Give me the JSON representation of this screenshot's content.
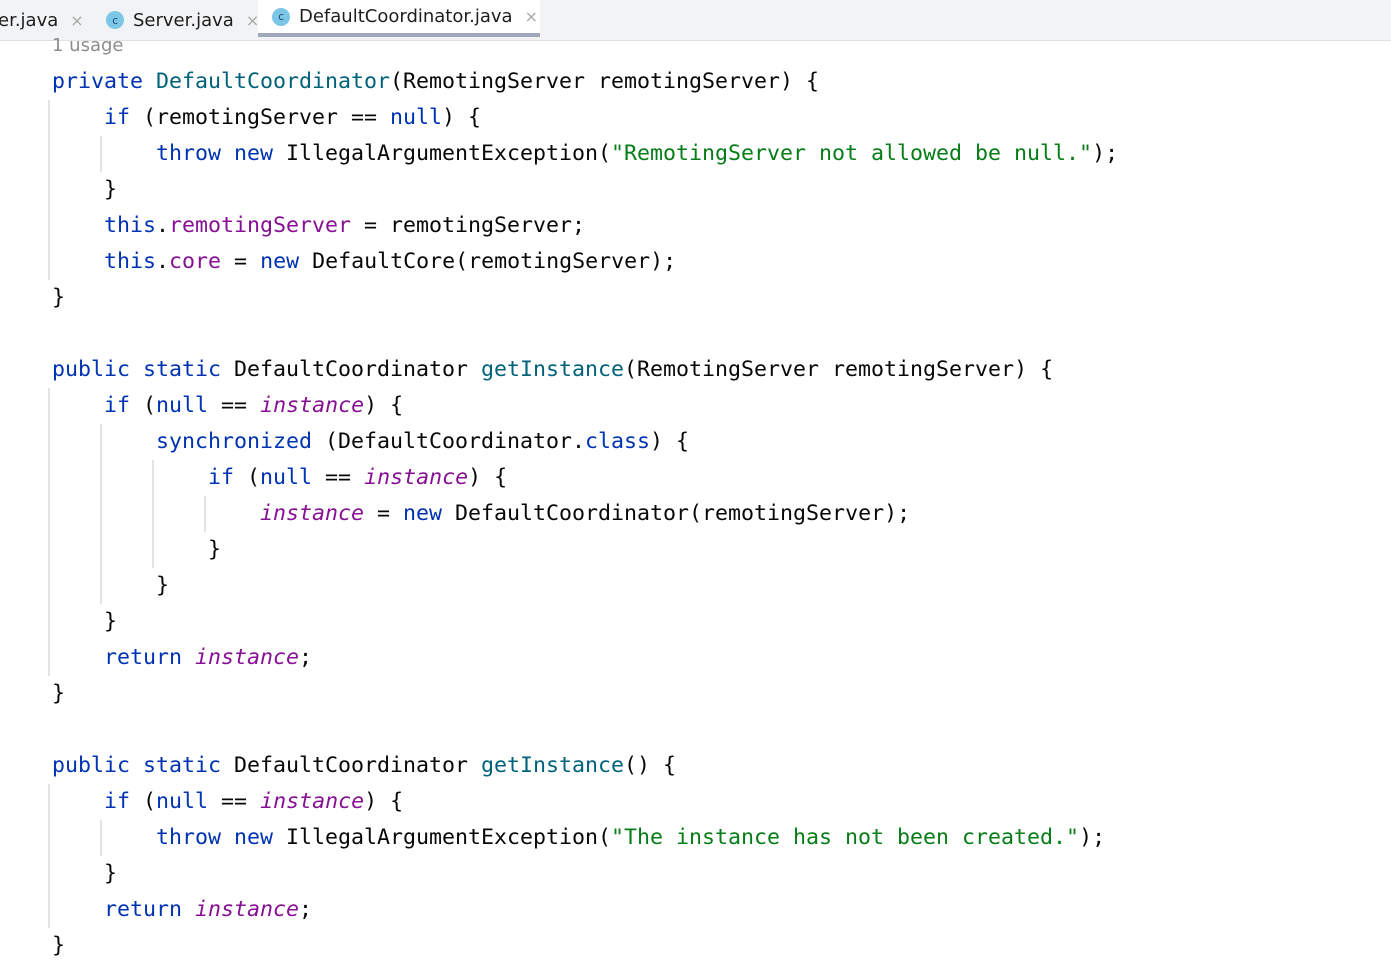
{
  "tabs": [
    {
      "label": "er.java",
      "icon": "class-icon",
      "active": false
    },
    {
      "label": "Server.java",
      "icon": "class-icon",
      "active": false
    },
    {
      "label": "DefaultCoordinator.java",
      "icon": "class-icon",
      "active": true
    }
  ],
  "class_icon_letter": "c",
  "close_glyph": "×",
  "usage_hint": "1 usage",
  "colors": {
    "keyword": "#0033b3",
    "method": "#00627a",
    "field": "#871094",
    "string": "#067d17",
    "text": "#080808"
  },
  "code_lines": [
    {
      "indent": 0,
      "tokens": [
        [
          "private ",
          "kw"
        ],
        [
          "DefaultCoordinator",
          "md"
        ],
        [
          "(RemotingServer remotingServer) {",
          "tx"
        ]
      ]
    },
    {
      "indent": 1,
      "tokens": [
        [
          "if ",
          "kw"
        ],
        [
          "(remotingServer == ",
          "tx"
        ],
        [
          "null",
          "kw"
        ],
        [
          ") {",
          "tx"
        ]
      ]
    },
    {
      "indent": 2,
      "tokens": [
        [
          "throw new ",
          "kw"
        ],
        [
          "IllegalArgumentException(",
          "tx"
        ],
        [
          "\"RemotingServer not allowed be null.\"",
          "st"
        ],
        [
          ");",
          "tx"
        ]
      ]
    },
    {
      "indent": 1,
      "tokens": [
        [
          "}",
          "tx"
        ]
      ]
    },
    {
      "indent": 1,
      "tokens": [
        [
          "this",
          "kw"
        ],
        [
          ".",
          "tx"
        ],
        [
          "remotingServer",
          "fd"
        ],
        [
          " = remotingServer;",
          "tx"
        ]
      ]
    },
    {
      "indent": 1,
      "tokens": [
        [
          "this",
          "kw"
        ],
        [
          ".",
          "tx"
        ],
        [
          "core",
          "fd"
        ],
        [
          " = ",
          "tx"
        ],
        [
          "new ",
          "kw"
        ],
        [
          "DefaultCore(remotingServer);",
          "tx"
        ]
      ]
    },
    {
      "indent": 0,
      "tokens": [
        [
          "}",
          "tx"
        ]
      ]
    },
    {
      "indent": 0,
      "tokens": []
    },
    {
      "indent": 0,
      "tokens": [
        [
          "public static ",
          "kw"
        ],
        [
          "DefaultCoordinator ",
          "tx"
        ],
        [
          "getInstance",
          "md"
        ],
        [
          "(RemotingServer remotingServer) {",
          "tx"
        ]
      ]
    },
    {
      "indent": 1,
      "tokens": [
        [
          "if ",
          "kw"
        ],
        [
          "(",
          "tx"
        ],
        [
          "null",
          "kw"
        ],
        [
          " == ",
          "tx"
        ],
        [
          "instance",
          "fd it"
        ],
        [
          ") {",
          "tx"
        ]
      ]
    },
    {
      "indent": 2,
      "tokens": [
        [
          "synchronized ",
          "kw"
        ],
        [
          "(DefaultCoordinator.",
          "tx"
        ],
        [
          "class",
          "kw"
        ],
        [
          ") {",
          "tx"
        ]
      ]
    },
    {
      "indent": 3,
      "tokens": [
        [
          "if ",
          "kw"
        ],
        [
          "(",
          "tx"
        ],
        [
          "null",
          "kw"
        ],
        [
          " == ",
          "tx"
        ],
        [
          "instance",
          "fd it"
        ],
        [
          ") {",
          "tx"
        ]
      ]
    },
    {
      "indent": 4,
      "tokens": [
        [
          "instance",
          "fd it"
        ],
        [
          " = ",
          "tx"
        ],
        [
          "new ",
          "kw"
        ],
        [
          "DefaultCoordinator(remotingServer);",
          "tx"
        ]
      ]
    },
    {
      "indent": 3,
      "tokens": [
        [
          "}",
          "tx"
        ]
      ]
    },
    {
      "indent": 2,
      "tokens": [
        [
          "}",
          "tx"
        ]
      ]
    },
    {
      "indent": 1,
      "tokens": [
        [
          "}",
          "tx"
        ]
      ]
    },
    {
      "indent": 1,
      "tokens": [
        [
          "return ",
          "kw"
        ],
        [
          "instance",
          "fd it"
        ],
        [
          ";",
          "tx"
        ]
      ]
    },
    {
      "indent": 0,
      "tokens": [
        [
          "}",
          "tx"
        ]
      ]
    },
    {
      "indent": 0,
      "tokens": []
    },
    {
      "indent": 0,
      "tokens": [
        [
          "public static ",
          "kw"
        ],
        [
          "DefaultCoordinator ",
          "tx"
        ],
        [
          "getInstance",
          "md"
        ],
        [
          "() {",
          "tx"
        ]
      ]
    },
    {
      "indent": 1,
      "tokens": [
        [
          "if ",
          "kw"
        ],
        [
          "(",
          "tx"
        ],
        [
          "null",
          "kw"
        ],
        [
          " == ",
          "tx"
        ],
        [
          "instance",
          "fd it"
        ],
        [
          ") {",
          "tx"
        ]
      ]
    },
    {
      "indent": 2,
      "tokens": [
        [
          "throw new ",
          "kw"
        ],
        [
          "IllegalArgumentException(",
          "tx"
        ],
        [
          "\"The instance has not been created.\"",
          "st"
        ],
        [
          ");",
          "tx"
        ]
      ]
    },
    {
      "indent": 1,
      "tokens": [
        [
          "}",
          "tx"
        ]
      ]
    },
    {
      "indent": 1,
      "tokens": [
        [
          "return ",
          "kw"
        ],
        [
          "instance",
          "fd it"
        ],
        [
          ";",
          "tx"
        ]
      ]
    },
    {
      "indent": 0,
      "tokens": [
        [
          "}",
          "tx"
        ]
      ]
    }
  ]
}
